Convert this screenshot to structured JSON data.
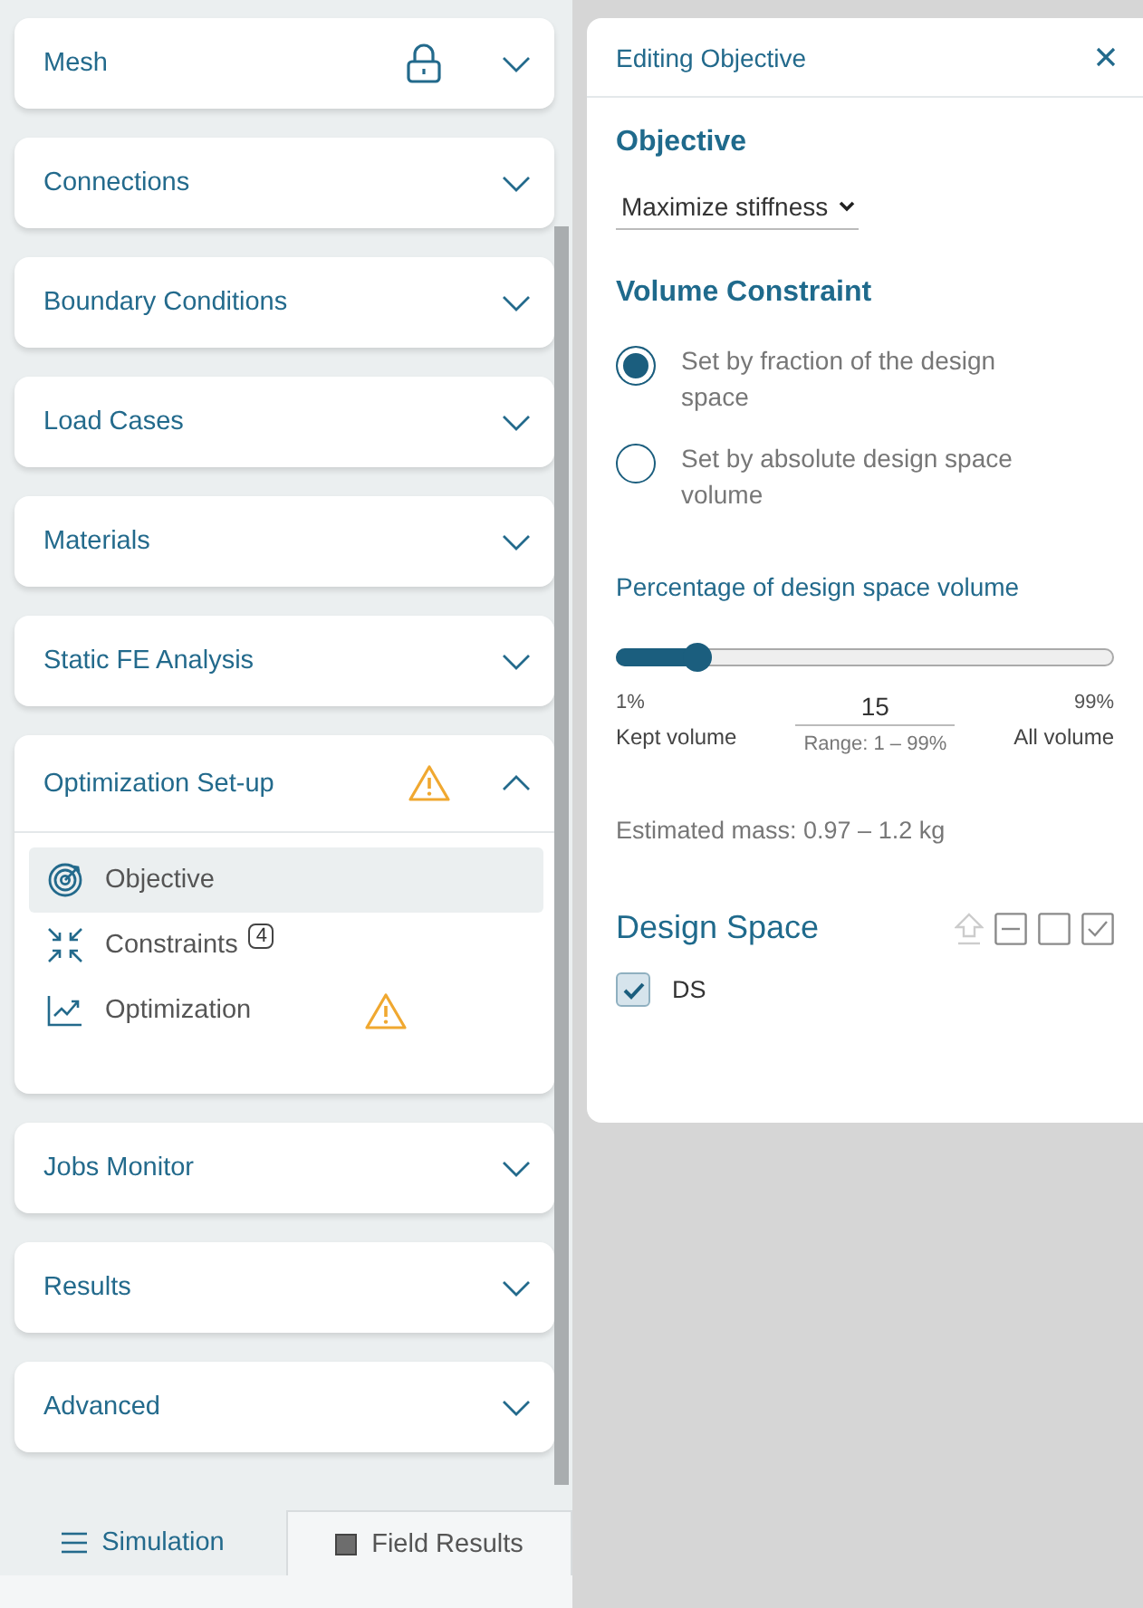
{
  "sections": [
    {
      "title": "Mesh",
      "expanded": false,
      "locked": true,
      "warning": false
    },
    {
      "title": "Connections",
      "expanded": false,
      "locked": false,
      "warning": false
    },
    {
      "title": "Boundary Conditions",
      "expanded": false,
      "locked": false,
      "warning": false
    },
    {
      "title": "Load Cases",
      "expanded": false,
      "locked": false,
      "warning": false
    },
    {
      "title": "Materials",
      "expanded": false,
      "locked": false,
      "warning": false
    },
    {
      "title": "Static FE Analysis",
      "expanded": false,
      "locked": false,
      "warning": false
    },
    {
      "title": "Optimization Set-up",
      "expanded": true,
      "locked": false,
      "warning": true,
      "items": [
        {
          "kind": "objective",
          "label": "Objective",
          "selected": true,
          "warning": false
        },
        {
          "kind": "constraints",
          "label": "Constraints",
          "count": "4",
          "selected": false,
          "warning": false
        },
        {
          "kind": "optimization",
          "label": "Optimization",
          "selected": false,
          "warning": true
        }
      ]
    },
    {
      "title": "Jobs Monitor",
      "expanded": false,
      "locked": false,
      "warning": false
    },
    {
      "title": "Results",
      "expanded": false,
      "locked": false,
      "warning": false
    },
    {
      "title": "Advanced",
      "expanded": false,
      "locked": false,
      "warning": false
    }
  ],
  "bottom_tabs": [
    {
      "kind": "menu",
      "label": "Simulation",
      "selected": true
    },
    {
      "kind": "square",
      "label": "Field Results",
      "selected": false
    }
  ],
  "editor": {
    "title": "Editing Objective",
    "objective_heading": "Objective",
    "objective_value": "Maximize stiffness",
    "volume_heading": "Volume Constraint",
    "options": [
      {
        "label": "Set by fraction of the design space",
        "selected": true
      },
      {
        "label": "Set by absolute design space volume",
        "selected": false
      }
    ],
    "slider": {
      "label": "Percentage of design space volume",
      "level": 0.165,
      "min": "1%",
      "max": "99%",
      "value": "15",
      "range": "Range: 1 – 99%",
      "min_caption": "Kept volume",
      "max_caption": "All volume"
    },
    "estimate": "Estimated mass: 0.97 – 1.2 kg",
    "design_space": {
      "title": "Design Space",
      "items": [
        {
          "label": "DS",
          "checked": true
        }
      ]
    }
  }
}
